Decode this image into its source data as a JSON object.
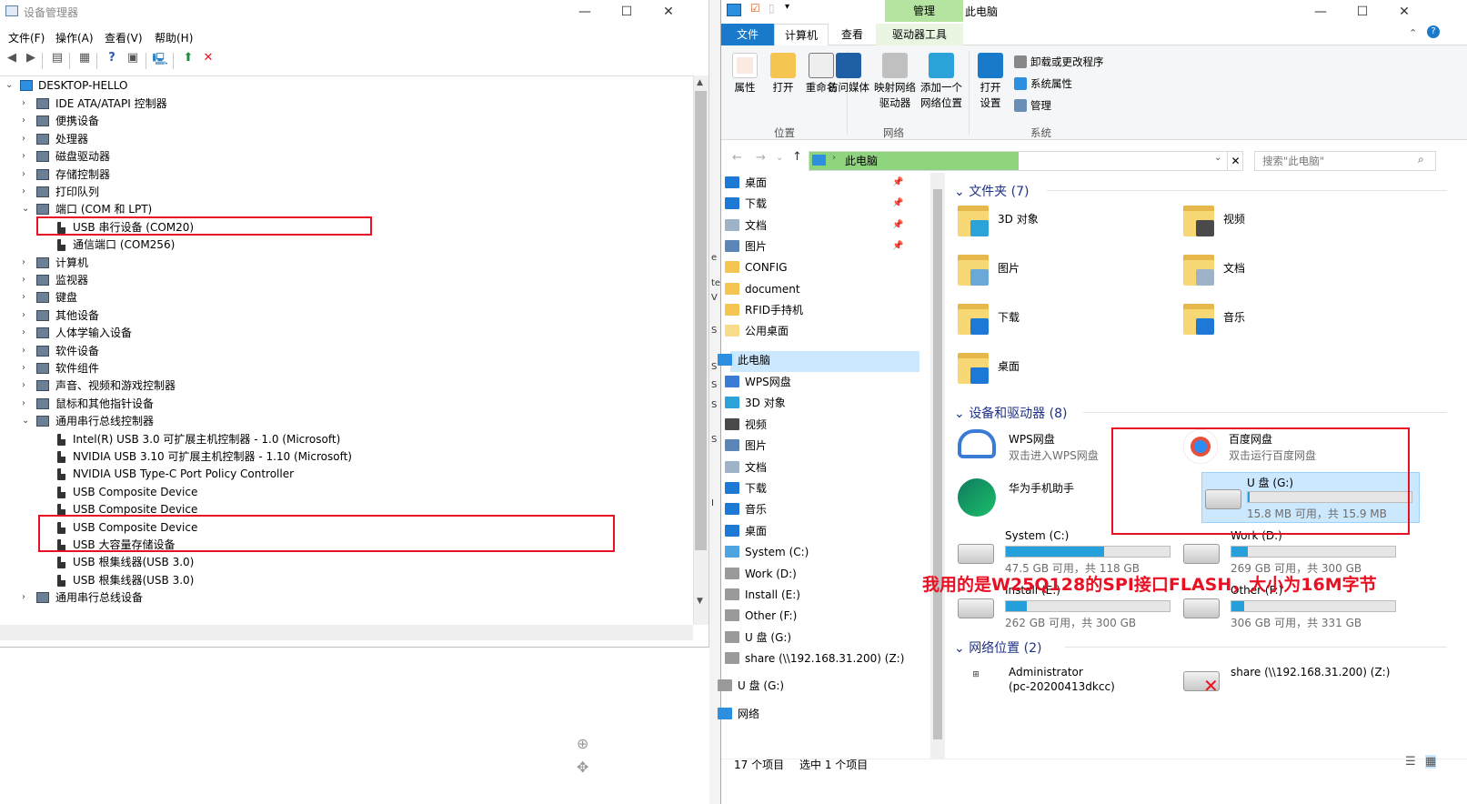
{
  "device_manager": {
    "title": "设备管理器",
    "menu": [
      "文件(F)",
      "操作(A)",
      "查看(V)",
      "帮助(H)"
    ],
    "root": "DESKTOP-HELLO",
    "tree": [
      {
        "label": "IDE ATA/ATAPI 控制器",
        "level": 1,
        "expander": "›"
      },
      {
        "label": "便携设备",
        "level": 1,
        "expander": "›"
      },
      {
        "label": "处理器",
        "level": 1,
        "expander": "›"
      },
      {
        "label": "磁盘驱动器",
        "level": 1,
        "expander": "›"
      },
      {
        "label": "存储控制器",
        "level": 1,
        "expander": "›"
      },
      {
        "label": "打印队列",
        "level": 1,
        "expander": "›"
      },
      {
        "label": "端口 (COM 和 LPT)",
        "level": 1,
        "expander": "⌄"
      },
      {
        "label": "USB 串行设备 (COM20)",
        "level": 2,
        "expander": ""
      },
      {
        "label": "通信端口 (COM256)",
        "level": 2,
        "expander": ""
      },
      {
        "label": "计算机",
        "level": 1,
        "expander": "›"
      },
      {
        "label": "监视器",
        "level": 1,
        "expander": "›"
      },
      {
        "label": "键盘",
        "level": 1,
        "expander": "›"
      },
      {
        "label": "其他设备",
        "level": 1,
        "expander": "›"
      },
      {
        "label": "人体学输入设备",
        "level": 1,
        "expander": "›"
      },
      {
        "label": "软件设备",
        "level": 1,
        "expander": "›"
      },
      {
        "label": "软件组件",
        "level": 1,
        "expander": "›"
      },
      {
        "label": "声音、视频和游戏控制器",
        "level": 1,
        "expander": "›"
      },
      {
        "label": "鼠标和其他指针设备",
        "level": 1,
        "expander": "›"
      },
      {
        "label": "通用串行总线控制器",
        "level": 1,
        "expander": "⌄"
      },
      {
        "label": "Intel(R) USB 3.0 可扩展主机控制器 - 1.0 (Microsoft)",
        "level": 2,
        "expander": ""
      },
      {
        "label": "NVIDIA USB 3.10 可扩展主机控制器 - 1.10 (Microsoft)",
        "level": 2,
        "expander": ""
      },
      {
        "label": "NVIDIA USB Type-C Port Policy Controller",
        "level": 2,
        "expander": ""
      },
      {
        "label": "USB Composite Device",
        "level": 2,
        "expander": ""
      },
      {
        "label": "USB Composite Device",
        "level": 2,
        "expander": ""
      },
      {
        "label": "USB Composite Device",
        "level": 2,
        "expander": ""
      },
      {
        "label": "USB 大容量存储设备",
        "level": 2,
        "expander": ""
      },
      {
        "label": "USB 根集线器(USB 3.0)",
        "level": 2,
        "expander": ""
      },
      {
        "label": "USB 根集线器(USB 3.0)",
        "level": 2,
        "expander": ""
      },
      {
        "label": "通用串行总线设备",
        "level": 1,
        "expander": "›"
      }
    ]
  },
  "explorer": {
    "title": "此电脑",
    "manage_tab": "管理",
    "tabs": [
      "文件",
      "计算机",
      "查看",
      "驱动器工具"
    ],
    "ribbon": {
      "location": {
        "group": "位置",
        "buttons": [
          "属性",
          "打开",
          "重命名"
        ]
      },
      "network": {
        "group": "网络",
        "buttons": [
          "访问媒体",
          "映射网络\n驱动器",
          "添加一个\n网络位置"
        ]
      },
      "system": {
        "group": "系统",
        "open_settings": "打开\n设置",
        "items": [
          "卸载或更改程序",
          "系统属性",
          "管理"
        ]
      }
    },
    "address": {
      "crumb": "此电脑",
      "search_placeholder": "搜索\"此电脑\""
    },
    "nav": {
      "quick": [
        {
          "label": "桌面",
          "pinned": true,
          "color": "#1e78d6"
        },
        {
          "label": "下载",
          "pinned": true,
          "color": "#1e78d6"
        },
        {
          "label": "文档",
          "pinned": true,
          "color": "#9fb3c8"
        },
        {
          "label": "图片",
          "pinned": true,
          "color": "#5b86b8"
        },
        {
          "label": "CONFIG",
          "pinned": false,
          "color": "#f4c550"
        },
        {
          "label": "document",
          "pinned": false,
          "color": "#f4c550"
        },
        {
          "label": "RFID手持机",
          "pinned": false,
          "color": "#f4c550"
        },
        {
          "label": "公用桌面",
          "pinned": false,
          "color": "#f8dc8a"
        }
      ],
      "this_pc": "此电脑",
      "pc_items": [
        {
          "label": "WPS网盘",
          "color": "#3a7bd5"
        },
        {
          "label": "3D 对象",
          "color": "#2ba3d8"
        },
        {
          "label": "视频",
          "color": "#4a4a4a"
        },
        {
          "label": "图片",
          "color": "#5b86b8"
        },
        {
          "label": "文档",
          "color": "#9fb3c8"
        },
        {
          "label": "下载",
          "color": "#1e78d6"
        },
        {
          "label": "音乐",
          "color": "#1e78d6"
        },
        {
          "label": "桌面",
          "color": "#1e78d6"
        },
        {
          "label": "System (C:)",
          "color": "#4fa3e0"
        },
        {
          "label": "Work (D:)",
          "color": "#9a9a9a"
        },
        {
          "label": "Install (E:)",
          "color": "#9a9a9a"
        },
        {
          "label": "Other (F:)",
          "color": "#9a9a9a"
        },
        {
          "label": "U 盘 (G:)",
          "color": "#9a9a9a"
        },
        {
          "label": "share (\\\\192.168.31.200) (Z:)",
          "color": "#9a9a9a"
        }
      ],
      "usb": "U 盘 (G:)",
      "network": "网络"
    },
    "folders_header": "文件夹 (7)",
    "folders": [
      "3D 对象",
      "视频",
      "图片",
      "文档",
      "下载",
      "音乐",
      "桌面"
    ],
    "devices_header": "设备和驱动器 (8)",
    "wps": {
      "name": "WPS网盘",
      "sub": "双击进入WPS网盘"
    },
    "baidu": {
      "name": "百度网盘",
      "sub": "双击运行百度网盘"
    },
    "huawei": {
      "name": "华为手机助手"
    },
    "drives": [
      {
        "name": "U 盘 (G:)",
        "free": "15.8 MB 可用，共 15.9 MB",
        "used_fraction": 0.01,
        "bar": "#26a0da"
      },
      {
        "name": "System (C:)",
        "free": "47.5 GB 可用，共 118 GB",
        "used_fraction": 0.6,
        "bar": "#26a0da"
      },
      {
        "name": "Work (D:)",
        "free": "269 GB 可用，共 300 GB",
        "used_fraction": 0.1,
        "bar": "#26a0da"
      },
      {
        "name": "Install (E:)",
        "free": "262 GB 可用，共 300 GB",
        "used_fraction": 0.13,
        "bar": "#26a0da"
      },
      {
        "name": "Other (F:)",
        "free": "306 GB 可用，共 331 GB",
        "used_fraction": 0.08,
        "bar": "#26a0da"
      }
    ],
    "network_header": "网络位置 (2)",
    "network_items": [
      {
        "name": "Administrator",
        "sub": "(pc-20200413dkcc)"
      },
      {
        "name": "share (\\\\192.168.31.200) (Z:)",
        "sub": ""
      }
    ],
    "status": {
      "count": "17 个项目",
      "selected": "选中 1 个项目"
    }
  },
  "annotation": "我用的是W25Q128的SPI接口FLASH，大小为16M字节",
  "colors": {
    "accent": "#1979ca",
    "highlight": "#e81123",
    "manage_green": "#b5e3a0"
  }
}
